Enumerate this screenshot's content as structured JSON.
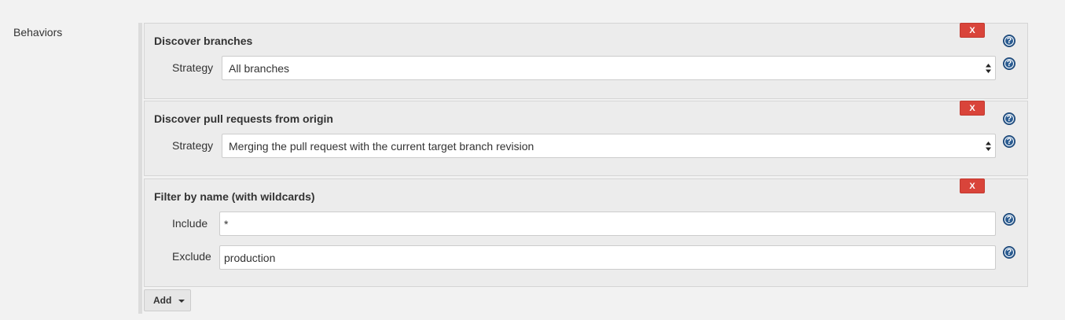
{
  "section": {
    "label": "Behaviors"
  },
  "panels": [
    {
      "title": "Discover branches",
      "delete_label": "X",
      "strategy_label": "Strategy",
      "strategy_value": "All branches"
    },
    {
      "title": "Discover pull requests from origin",
      "delete_label": "X",
      "strategy_label": "Strategy",
      "strategy_value": "Merging the pull request with the current target branch revision"
    },
    {
      "title": "Filter by name (with wildcards)",
      "delete_label": "X",
      "include_label": "Include",
      "include_value": "*",
      "exclude_label": "Exclude",
      "exclude_value": "production"
    }
  ],
  "help": {
    "glyph": "?"
  },
  "add_button": {
    "label": "Add"
  },
  "colors": {
    "delete_button": "#d9443a",
    "help_icon": "#2b5c91",
    "panel_background": "#ececec",
    "page_background": "#f2f2f2"
  }
}
